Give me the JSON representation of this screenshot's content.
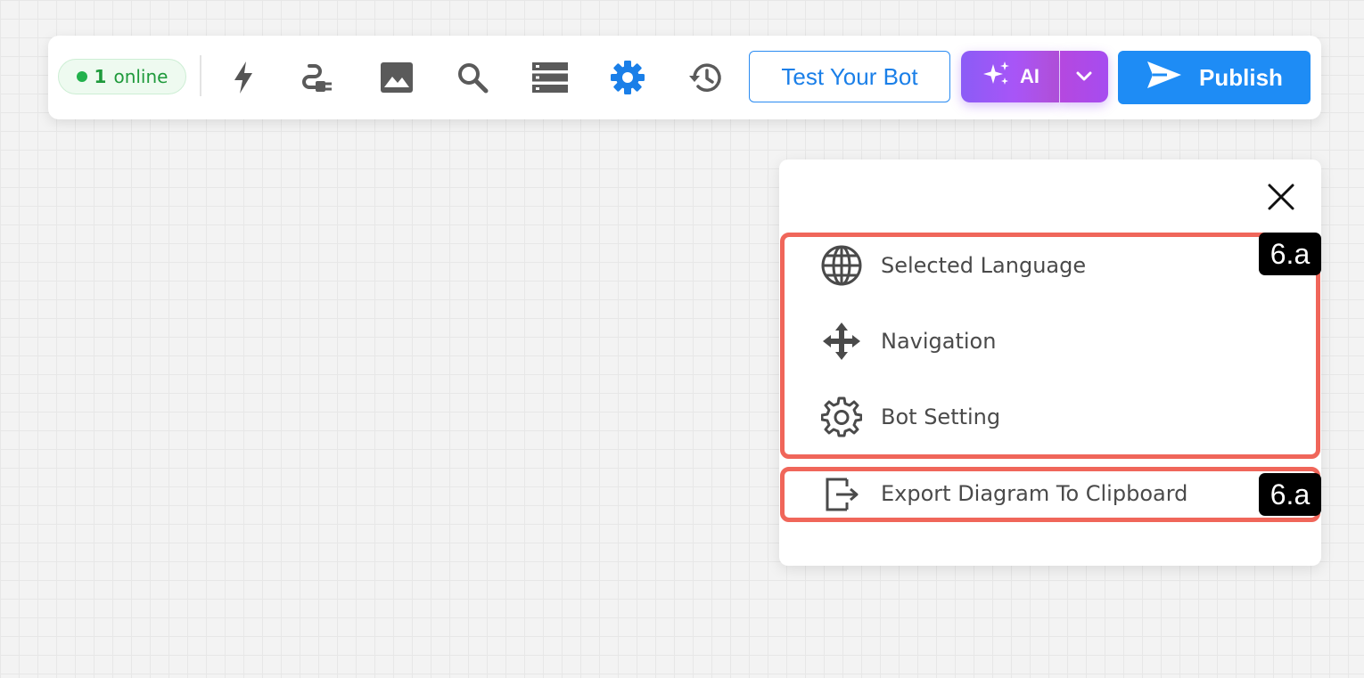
{
  "toolbar": {
    "online_count": "1",
    "online_label": "online",
    "test_bot_label": "Test Your Bot",
    "ai_label": "AI",
    "publish_label": "Publish"
  },
  "tool_icons": [
    "bolt-icon",
    "plug-icon",
    "image-icon",
    "search-icon",
    "list-icon",
    "gear-icon",
    "history-icon"
  ],
  "settings_panel": {
    "close_label": "X",
    "items": [
      {
        "icon": "globe-icon",
        "label": "Selected Language"
      },
      {
        "icon": "move-arrows-icon",
        "label": "Navigation"
      },
      {
        "icon": "gear-outline-icon",
        "label": "Bot Setting"
      },
      {
        "icon": "export-icon",
        "label": "Export Diagram To Clipboard"
      }
    ]
  },
  "annotations": {
    "badge_1": "6.a",
    "badge_2": "6.a"
  },
  "colors": {
    "accent_blue": "#1e8cf5",
    "ai_purple": "#a855f7",
    "online_green": "#22b14c",
    "highlight": "#f0665a",
    "active_icon": "#1a7fe8",
    "icon_gray": "#5a5a5a"
  }
}
